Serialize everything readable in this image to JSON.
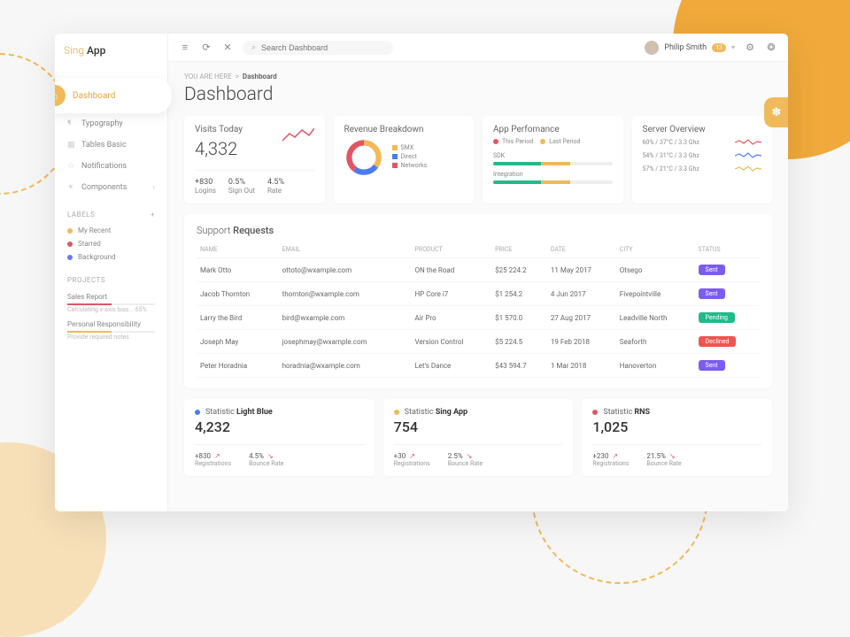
{
  "brand": {
    "a": "Sing",
    "b": "App"
  },
  "sidebar": {
    "items": [
      {
        "label": "Dashboard"
      },
      {
        "label": "Typography"
      },
      {
        "label": "Tables Basic"
      },
      {
        "label": "Notifications"
      },
      {
        "label": "Components"
      }
    ],
    "labels_hdr": "LABELS",
    "labels": [
      {
        "label": "My Recent",
        "color": "#f0b95a"
      },
      {
        "label": "Starred",
        "color": "#e25563"
      },
      {
        "label": "Background",
        "color": "#6979f8"
      }
    ],
    "projects_hdr": "PROJECTS",
    "projects": [
      {
        "label": "Sales Report",
        "sub": "Calculating x-axis bias... 65%",
        "color": "#e25563"
      },
      {
        "label": "Personal Responsibility",
        "sub": "Provide required notes",
        "color": "#f0b95a"
      }
    ]
  },
  "topbar": {
    "search_placeholder": "Search Dashboard",
    "user_name": "Philip Smith",
    "badge": "13"
  },
  "breadcrumb": {
    "pre": "YOU ARE HERE",
    "current": "Dashboard"
  },
  "page_title": "Dashboard",
  "visits": {
    "title": "Visits Today",
    "value": "4,332",
    "stats": [
      {
        "v": "+830",
        "l": "Logins"
      },
      {
        "v": "0.5%",
        "l": "Sign Out"
      },
      {
        "v": "4.5%",
        "l": "Rate"
      }
    ]
  },
  "revenue": {
    "title": "Revenue Breakdown",
    "legend": [
      {
        "label": "SMX",
        "color": "#f0b95a"
      },
      {
        "label": "Direct",
        "color": "#4a7cf0"
      },
      {
        "label": "Networks",
        "color": "#e25563"
      }
    ]
  },
  "perf": {
    "title": "App Perfomance",
    "legend": [
      {
        "label": "This Period",
        "color": "#e25563"
      },
      {
        "label": "Last Period",
        "color": "#f0b95a"
      }
    ],
    "rows": [
      {
        "label": "SDK"
      },
      {
        "label": "Integration"
      }
    ]
  },
  "server": {
    "title": "Server Overview",
    "rows": [
      {
        "label": "60% / 37°C / 3.3 Ghz",
        "color": "#e25563"
      },
      {
        "label": "54% / 31°C / 3.3 Ghz",
        "color": "#4a7cf0"
      },
      {
        "label": "57% / 21°C / 3.3 Ghz",
        "color": "#f0b95a"
      }
    ]
  },
  "table": {
    "title_a": "Support",
    "title_b": "Requests",
    "headers": [
      "NAME",
      "EMAIL",
      "PRODUCT",
      "PRICE",
      "DATE",
      "CITY",
      "STATUS"
    ],
    "rows": [
      {
        "name": "Mark Otto",
        "email": "ottoto@wxample.com",
        "product": "ON the Road",
        "price": "$25 224.2",
        "date": "11 May 2017",
        "city": "Otsego",
        "status": "Sent",
        "color": "#7b5cf0"
      },
      {
        "name": "Jacob Thornton",
        "email": "thornton@wxample.com",
        "product": "HP Core i7",
        "price": "$1 254.2",
        "date": "4 Jun 2017",
        "city": "Fivepointville",
        "status": "Sent",
        "color": "#7b5cf0"
      },
      {
        "name": "Larry the Bird",
        "email": "bird@wxample.com",
        "product": "Air Pro",
        "price": "$1 570.0",
        "date": "27 Aug 2017",
        "city": "Leadville North",
        "status": "Pending",
        "color": "#21ba8a"
      },
      {
        "name": "Joseph May",
        "email": "josephmay@wxample.com",
        "product": "Version Control",
        "price": "$5 224.5",
        "date": "19 Feb 2018",
        "city": "Seaforth",
        "status": "Declined",
        "color": "#f0544f"
      },
      {
        "name": "Peter Horadnia",
        "email": "horadnia@wxample.com",
        "product": "Let's Dance",
        "price": "$43 594.7",
        "date": "1 Mar 2018",
        "city": "Hanoverton",
        "status": "Sent",
        "color": "#7b5cf0"
      }
    ]
  },
  "stats": [
    {
      "dot": "#4a7cf0",
      "pre": "Statistic",
      "name": "Light Blue",
      "value": "4,232",
      "sub": [
        {
          "v": "+830",
          "l": "Registrations"
        },
        {
          "v": "4.5%",
          "l": "Bounce Rate"
        }
      ]
    },
    {
      "dot": "#f0b95a",
      "pre": "Statistic",
      "name": "Sing App",
      "value": "754",
      "sub": [
        {
          "v": "+30",
          "l": "Registrations"
        },
        {
          "v": "2.5%",
          "l": "Bounce Rate"
        }
      ]
    },
    {
      "dot": "#e25563",
      "pre": "Statistic",
      "name": "RNS",
      "value": "1,025",
      "sub": [
        {
          "v": "+230",
          "l": "Registrations"
        },
        {
          "v": "21.5%",
          "l": "Bounce Rate"
        }
      ]
    }
  ]
}
